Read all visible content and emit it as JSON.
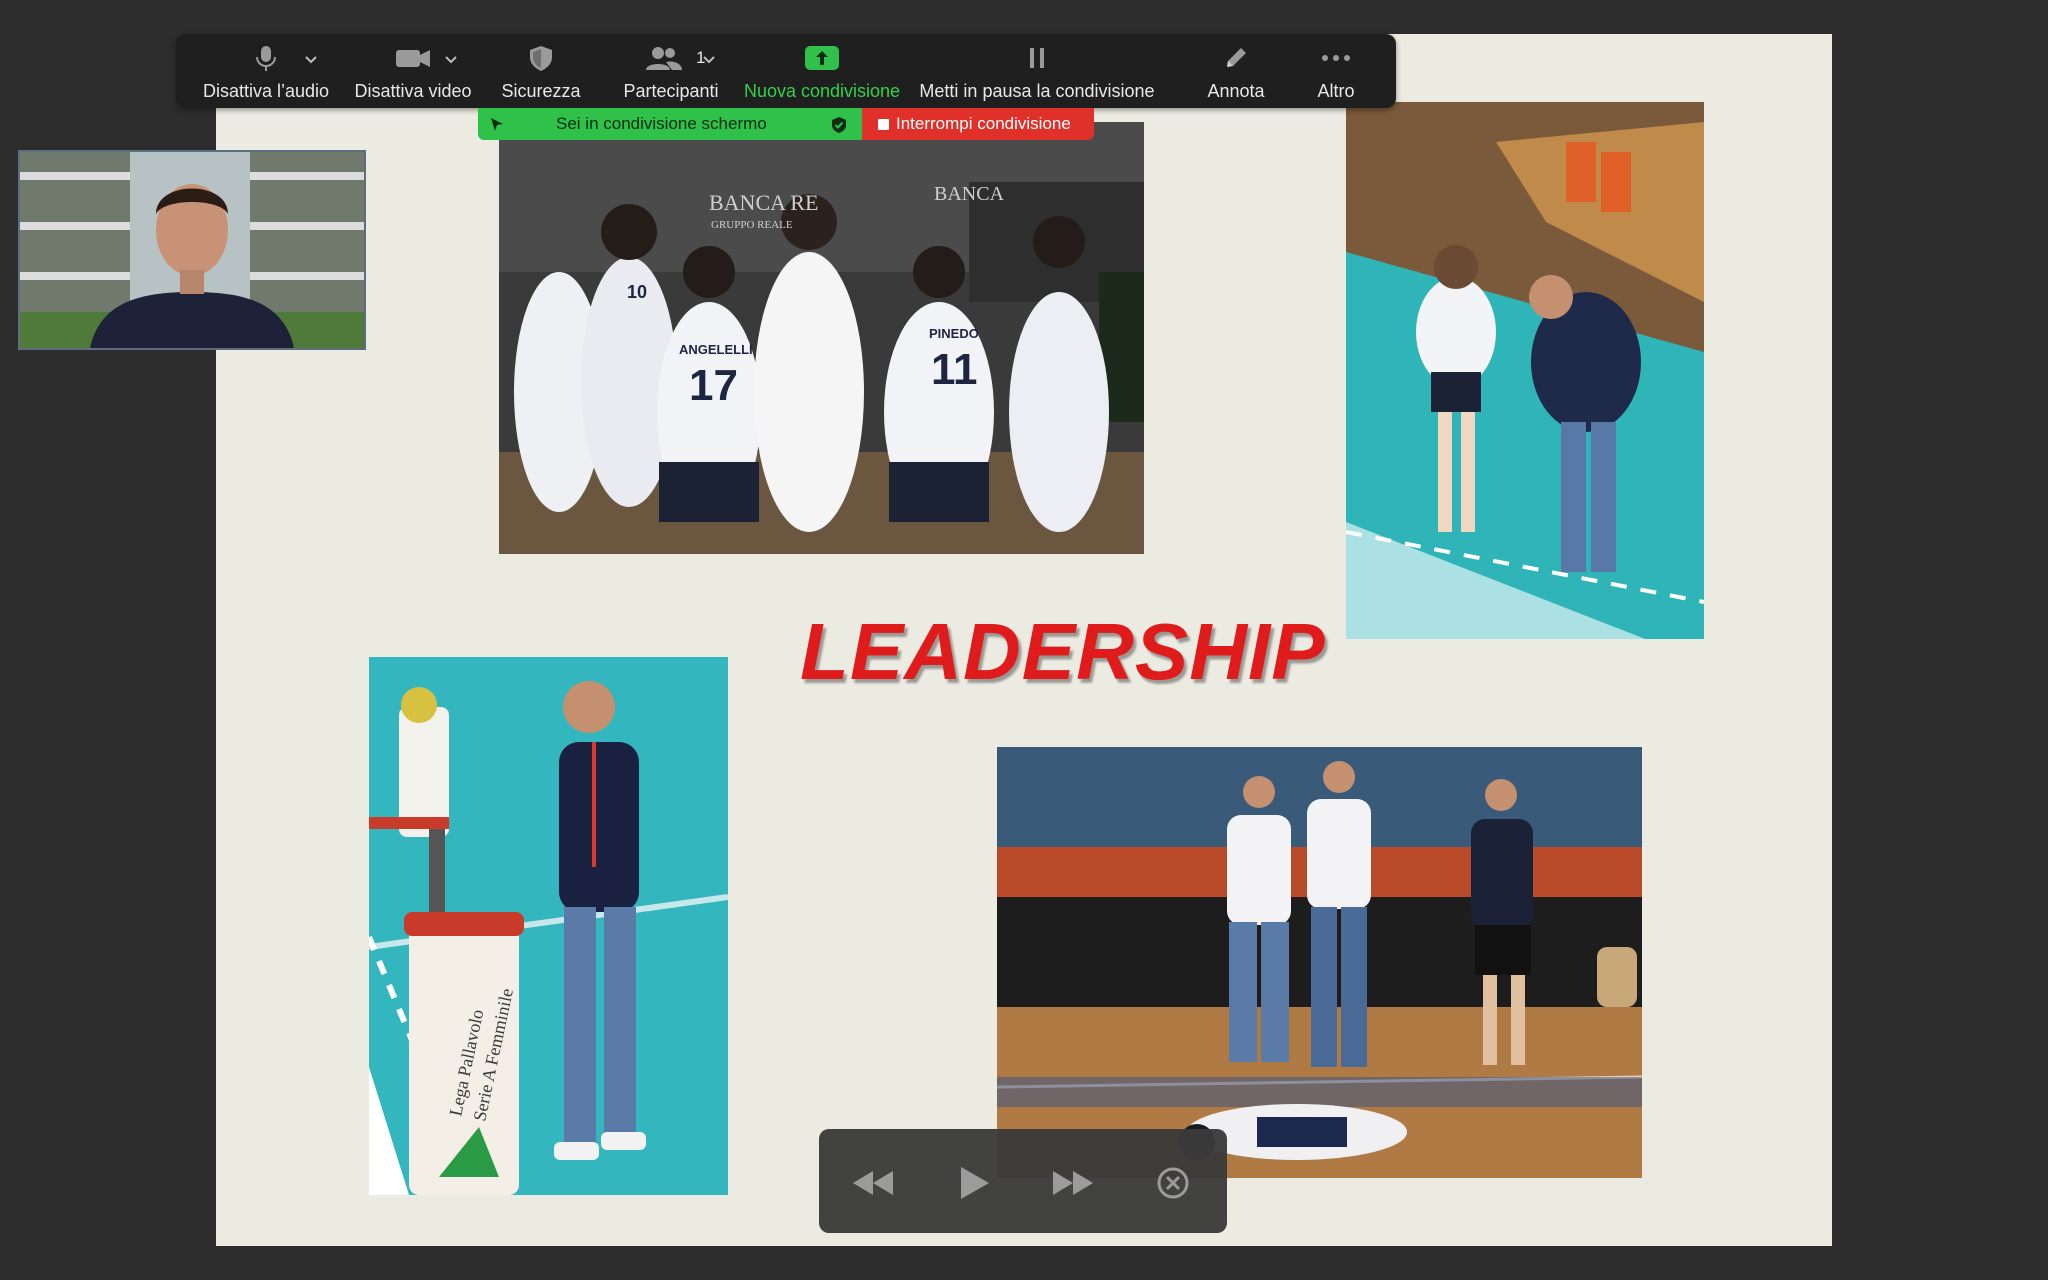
{
  "toolbar": {
    "audio_label": "Disattiva l’audio",
    "video_label": "Disattiva video",
    "security_label": "Sicurezza",
    "participants_label": "Partecipanti",
    "participants_count": "1",
    "new_share_label": "Nuova condivisione",
    "pause_label": "Metti in pausa la condivisione",
    "annotate_label": "Annota",
    "more_label": "Altro",
    "accent_green": "#33d14a"
  },
  "share_banner": {
    "status_text": "Sei in condivisione schermo",
    "stop_label": "Interrompi condivisione",
    "banner_color": "#2fc149",
    "stop_color": "#e0302a"
  },
  "slide": {
    "title": "LEADERSHIP",
    "title_color": "#e01b1b",
    "photos": [
      {
        "name": "team-huddle-photo",
        "texts": [
          "BANCA RE",
          "GRUPPO REALE",
          "BANCA",
          "ANGELELLI",
          "17",
          "PINEDO",
          "11",
          "10"
        ]
      },
      {
        "name": "coach-player-court-photo"
      },
      {
        "name": "coach-courtside-photo",
        "texts": [
          "Lega Pallavolo",
          "Serie A Femminile"
        ]
      },
      {
        "name": "staff-bench-photo"
      }
    ]
  },
  "media_controls": {
    "buttons": [
      "rewind-icon",
      "play-icon",
      "fast-forward-icon",
      "close-icon"
    ]
  }
}
